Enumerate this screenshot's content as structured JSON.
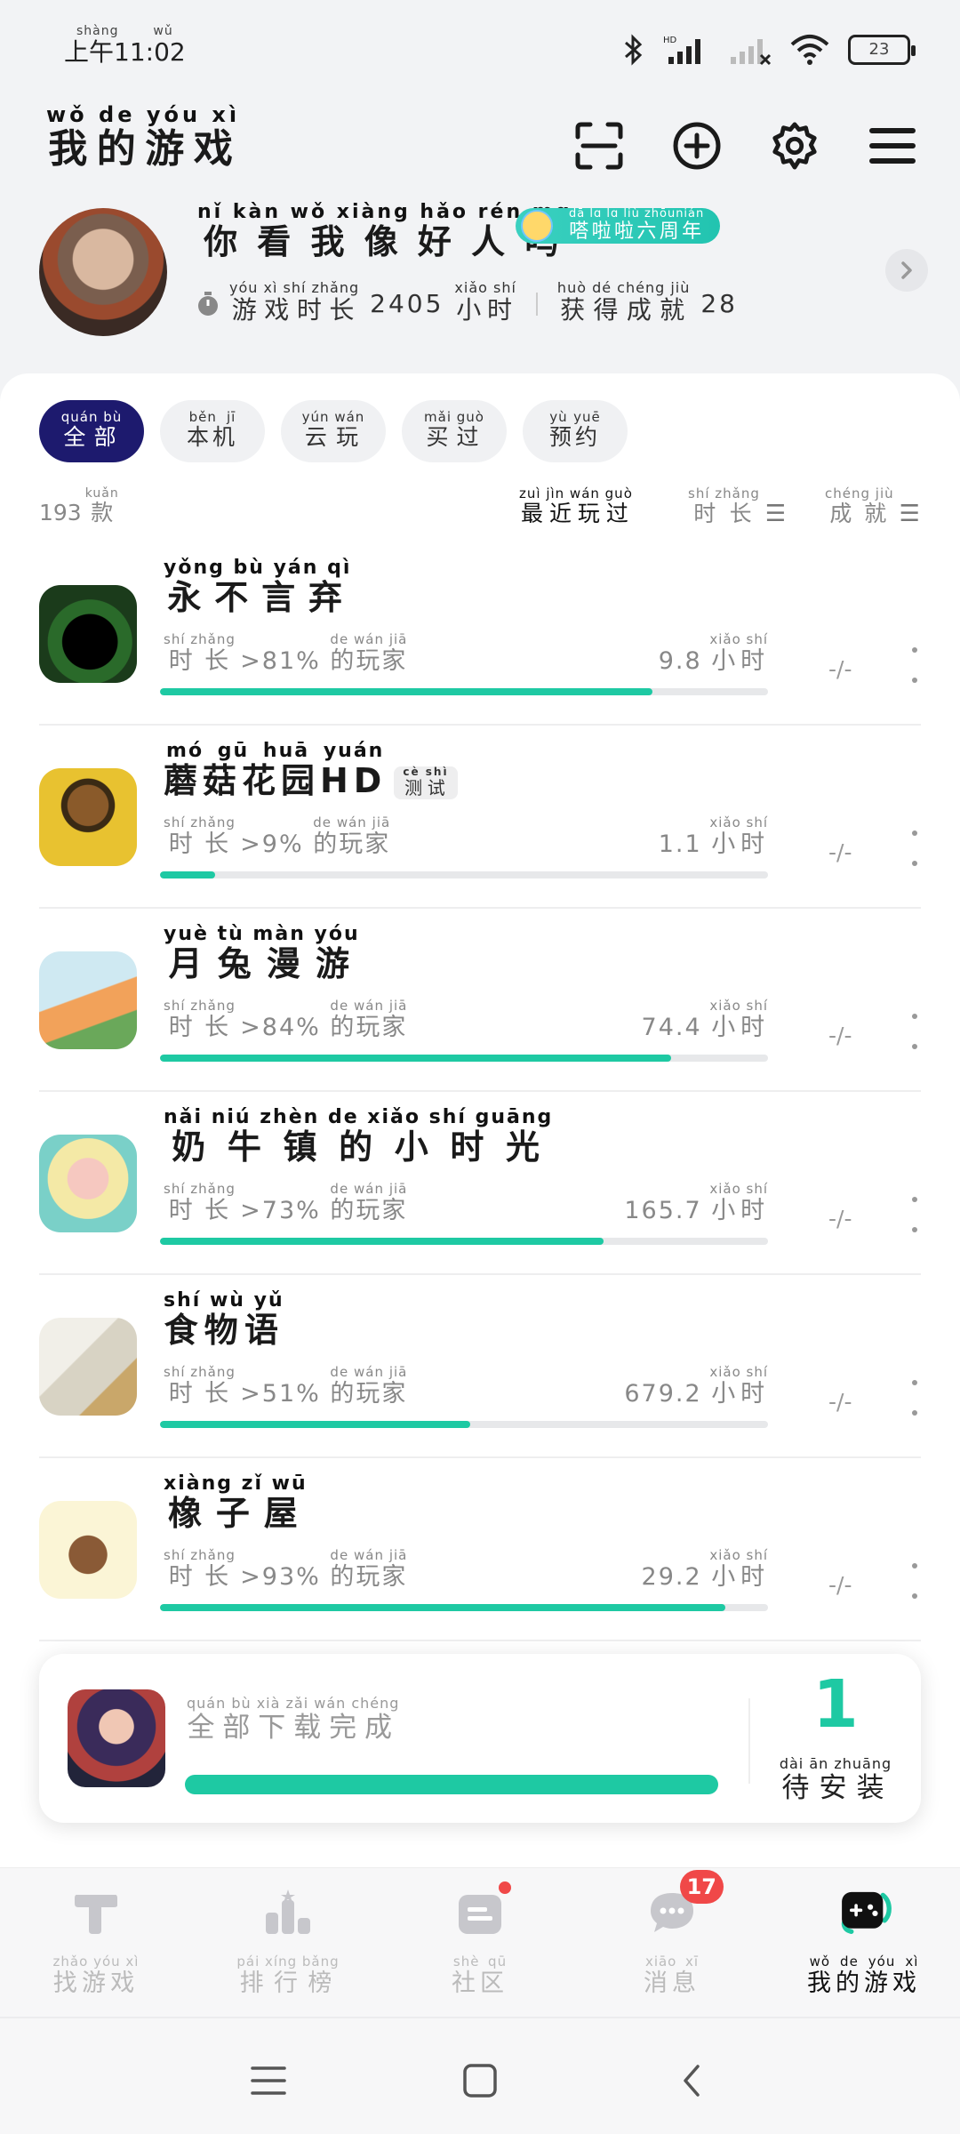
{
  "status_bar": {
    "time": "上午11:02",
    "time_pinyin": "shàng wǔ",
    "battery": "23"
  },
  "header": {
    "title": "我的游戏",
    "title_pinyin": "wǒ de yóu xì"
  },
  "profile": {
    "username": "你看我像好人吗",
    "username_pinyin": "nǐ kàn wǒ xiàng hǎo rén mɑ",
    "badge": "嗒啦啦六周年",
    "badge_pinyin": "dā lɑ lɑ liù zhōunián",
    "playtime_label": "游戏时长",
    "playtime_label_pinyin": "yóu xì shí zhǎng",
    "playtime_value": "2405",
    "playtime_unit": "小时",
    "playtime_unit_pinyin": "xiǎo shí",
    "achievements_label": "获得成就",
    "achievements_label_pinyin": "huò dé chéng jiù",
    "achievements_value": "28"
  },
  "filters": [
    {
      "label": "全部",
      "pinyin": "quán bù",
      "active": true
    },
    {
      "label": "本机",
      "pinyin": "běn jī",
      "active": false
    },
    {
      "label": "云玩",
      "pinyin": "yún wán",
      "active": false
    },
    {
      "label": "买过",
      "pinyin": "mǎi guò",
      "active": false
    },
    {
      "label": "预约",
      "pinyin": "yù yuē",
      "active": false
    }
  ],
  "sort": {
    "count": "193",
    "count_unit": "款",
    "count_unit_pinyin": "kuǎn",
    "recent": "最近玩过",
    "recent_pinyin": "zuì jìn wán guò",
    "playtime": "时长",
    "playtime_pinyin": "shí zhǎng",
    "achievement": "成就",
    "achievement_pinyin": "chéng jiù"
  },
  "common": {
    "duration_label": "时长",
    "duration_pinyin": "shí zhǎng",
    "players_label": "的玩家",
    "players_pinyin": "de wán jiā",
    "hours_unit": "小时",
    "hours_pinyin": "xiǎo shí"
  },
  "games": [
    {
      "name": "永不言弃",
      "pinyin": "yǒng bù yán qì",
      "tag": "",
      "tag_pinyin": "",
      "percent": ">81%",
      "hours": "9.8",
      "achievement": "-/-",
      "progress": 0.81
    },
    {
      "name": "蘑菇花园HD",
      "pinyin": "mó gū huā yuán",
      "tag": "测试",
      "tag_pinyin": "cè shì",
      "percent": ">9%",
      "hours": "1.1",
      "achievement": "-/-",
      "progress": 0.09
    },
    {
      "name": "月兔漫游",
      "pinyin": "yuè tù màn yóu",
      "tag": "",
      "tag_pinyin": "",
      "percent": ">84%",
      "hours": "74.4",
      "achievement": "-/-",
      "progress": 0.84
    },
    {
      "name": "奶牛镇的小时光",
      "pinyin": "nǎi niú zhèn de xiǎo shí guāng",
      "tag": "",
      "tag_pinyin": "",
      "percent": ">73%",
      "hours": "165.7",
      "achievement": "-/-",
      "progress": 0.73
    },
    {
      "name": "食物语",
      "pinyin": "shí wù yǔ",
      "tag": "",
      "tag_pinyin": "",
      "percent": ">51%",
      "hours": "679.2",
      "achievement": "-/-",
      "progress": 0.51
    },
    {
      "name": "橡子屋",
      "pinyin": "xiàng zǐ wū",
      "tag": "",
      "tag_pinyin": "",
      "percent": ">93%",
      "hours": "29.2",
      "achievement": "-/-",
      "progress": 0.93
    }
  ],
  "download": {
    "status": "全部下载完成",
    "status_pinyin": "quán bù xià zǎi wán chéng",
    "count": "1",
    "pending": "待安装",
    "pending_pinyin": "dài ān zhuāng",
    "progress": 1.0
  },
  "tabs": [
    {
      "label": "找游戏",
      "pinyin": "zhǎo yóu xì",
      "icon": "find-game-icon",
      "active": false
    },
    {
      "label": "排行榜",
      "pinyin": "pái xíng bǎng",
      "icon": "ranking-icon",
      "active": false
    },
    {
      "label": "社区",
      "pinyin": "shè qū",
      "icon": "community-icon",
      "active": false
    },
    {
      "label": "消息",
      "pinyin": "xiāo xī",
      "icon": "message-icon",
      "active": false,
      "badge": "17"
    },
    {
      "label": "我的游戏",
      "pinyin": "wǒ de yóu xì",
      "icon": "gamepad-icon",
      "active": true
    }
  ],
  "colors": {
    "accent": "#1ec9a3",
    "active_chip": "#1d1a6e",
    "badge_red": "#f04848"
  }
}
